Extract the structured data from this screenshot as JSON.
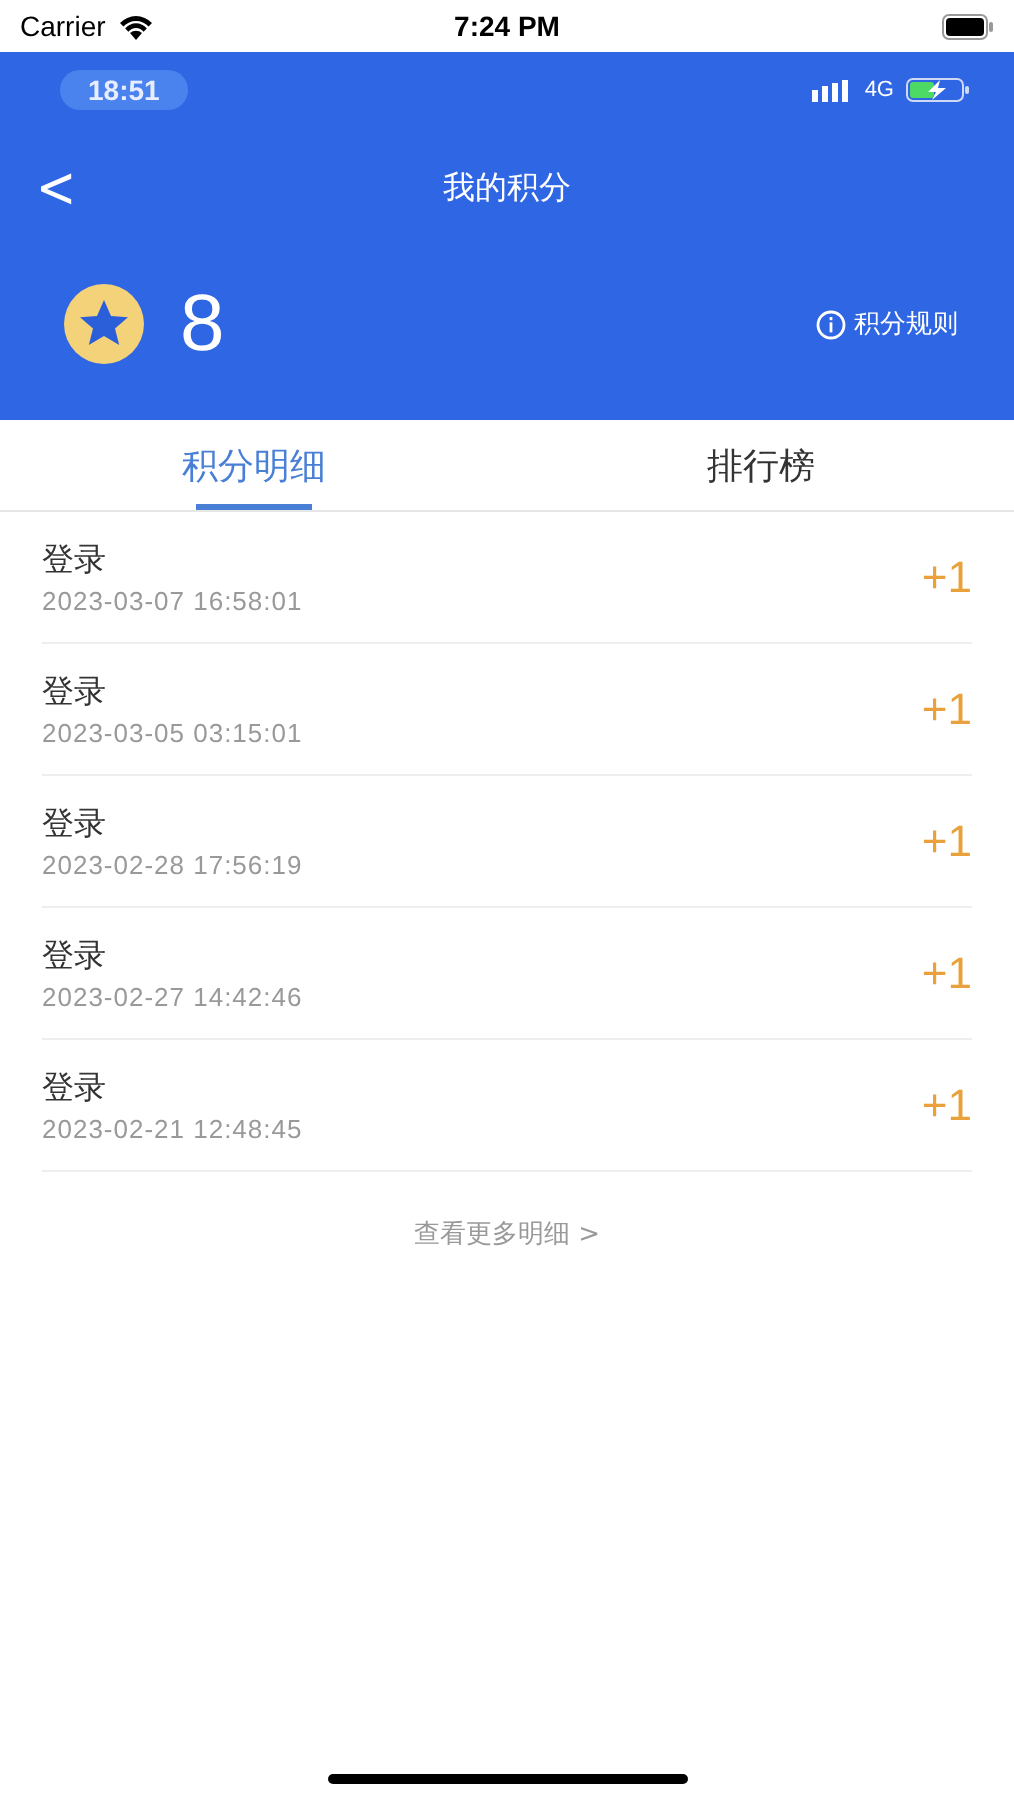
{
  "status_bar": {
    "carrier": "Carrier",
    "time": "7:24 PM"
  },
  "inner_status_bar": {
    "time": "18:51",
    "network": "4G"
  },
  "nav": {
    "back": "<",
    "title": "我的积分"
  },
  "points": {
    "value": "8",
    "rules_link": "积分规则"
  },
  "tabs": [
    {
      "label": "积分明细",
      "selected": true
    },
    {
      "label": "排行榜",
      "selected": false
    }
  ],
  "records": [
    {
      "title": "登录",
      "time": "2023-03-07 16:58:01",
      "points": "+1"
    },
    {
      "title": "登录",
      "time": "2023-03-05 03:15:01",
      "points": "+1"
    },
    {
      "title": "登录",
      "time": "2023-02-28 17:56:19",
      "points": "+1"
    },
    {
      "title": "登录",
      "time": "2023-02-27 14:42:46",
      "points": "+1"
    },
    {
      "title": "登录",
      "time": "2023-02-21 12:48:45",
      "points": "+1"
    }
  ],
  "more_link": "查看更多明细 >"
}
